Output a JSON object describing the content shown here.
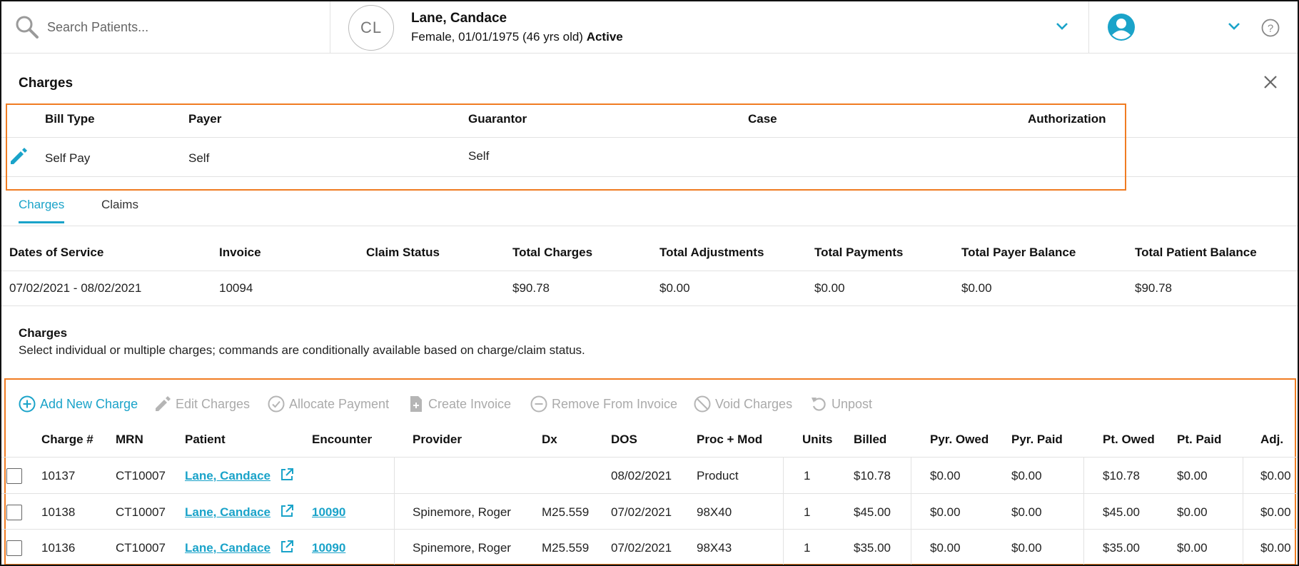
{
  "search": {
    "placeholder": "Search Patients..."
  },
  "patient": {
    "initials": "CL",
    "name": "Lane, Candace",
    "info": "Female, 01/01/1975 (46 yrs old)",
    "status": "Active"
  },
  "panel": {
    "title": "Charges"
  },
  "bill": {
    "headers": {
      "bill_type": "Bill Type",
      "payer": "Payer",
      "guarantor": "Guarantor",
      "case": "Case",
      "authorization": "Authorization"
    },
    "values": {
      "bill_type": "Self Pay",
      "payer": "Self",
      "guarantor": "Self"
    }
  },
  "tabs": [
    {
      "label": "Charges",
      "active": true
    },
    {
      "label": "Claims",
      "active": false
    }
  ],
  "summary": {
    "headers": [
      "Dates of Service",
      "Invoice",
      "Claim Status",
      "Total Charges",
      "Total Adjustments",
      "Total Payments",
      "Total Payer Balance",
      "Total Patient Balance"
    ],
    "values": [
      "07/02/2021 - 08/02/2021",
      "10094",
      "",
      "$90.78",
      "$0.00",
      "$0.00",
      "$0.00",
      "$90.78"
    ]
  },
  "charges_section": {
    "title": "Charges",
    "description": "Select individual or multiple charges; commands are conditionally available based on charge/claim status."
  },
  "toolbar": {
    "add": "Add New Charge",
    "edit": "Edit Charges",
    "allocate": "Allocate Payment",
    "create_invoice": "Create Invoice",
    "remove_invoice": "Remove From Invoice",
    "void": "Void Charges",
    "unpost": "Unpost"
  },
  "table": {
    "headers": [
      "Charge #",
      "MRN",
      "Patient",
      "Encounter",
      "Provider",
      "Dx",
      "DOS",
      "Proc + Mod",
      "Units",
      "Billed",
      "Pyr. Owed",
      "Pyr. Paid",
      "Pt. Owed",
      "Pt. Paid",
      "Adj."
    ],
    "rows": [
      [
        "10137",
        "CT10007",
        "Lane, Candace",
        "",
        "",
        "",
        "08/02/2021",
        "Product",
        "1",
        "$10.78",
        "$0.00",
        "$0.00",
        "$10.78",
        "$0.00",
        "$0.00"
      ],
      [
        "10138",
        "CT10007",
        "Lane, Candace",
        "10090",
        "Spinemore, Roger",
        "M25.559",
        "07/02/2021",
        "98X40",
        "1",
        "$45.00",
        "$0.00",
        "$0.00",
        "$45.00",
        "$0.00",
        "$0.00"
      ],
      [
        "10136",
        "CT10007",
        "Lane, Candace",
        "10090",
        "Spinemore, Roger",
        "M25.559",
        "07/02/2021",
        "98X43",
        "1",
        "$35.00",
        "$0.00",
        "$0.00",
        "$35.00",
        "$0.00",
        "$0.00"
      ]
    ]
  },
  "icons": {
    "search": "search-icon",
    "chevron": "chevron-down-icon",
    "user": "user-avatar-icon",
    "help": "help-icon",
    "close": "close-icon",
    "edit": "pencil-icon",
    "external": "external-link-icon"
  },
  "colors": {
    "accent": "#1aa3c9",
    "highlight": "#f07c22"
  }
}
